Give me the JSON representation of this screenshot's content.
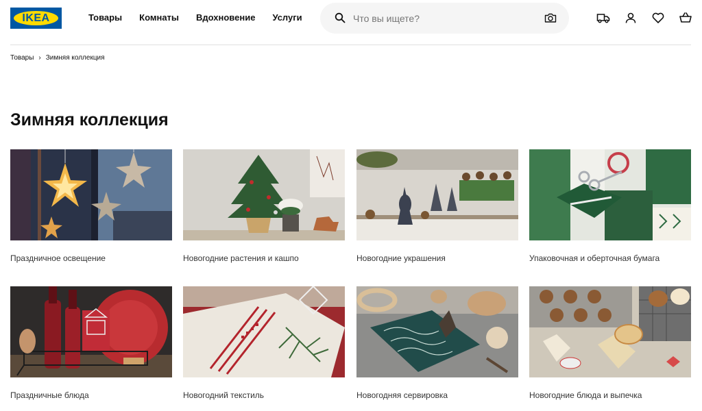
{
  "header": {
    "logo_text": "IKEA",
    "nav": [
      "Товары",
      "Комнаты",
      "Вдохновение",
      "Услуги"
    ],
    "search_placeholder": "Что вы ищете?",
    "icons": [
      "truck-icon",
      "user-icon",
      "heart-icon",
      "basket-icon"
    ]
  },
  "breadcrumb": {
    "items": [
      "Товары",
      "Зимняя коллекция"
    ]
  },
  "page": {
    "title": "Зимняя коллекция"
  },
  "categories": [
    {
      "label": "Праздничное освещение",
      "image": "Бумажные звёзды-светильники на окне"
    },
    {
      "label": "Новогодние растения и кашпо",
      "image": "Ёлочка в кашпо и пуансеттия"
    },
    {
      "label": "Новогодние украшения",
      "image": "Фигурки гномов и шишки на полке"
    },
    {
      "label": "Упаковочная и оберточная бумага",
      "image": "Зелёная подарочная бумага и ножницы"
    },
    {
      "label": "Праздничные блюда",
      "image": "Красные бутылки и корзина"
    },
    {
      "label": "Новогодний текстиль",
      "image": "Подарок в текстиле с веткой ели"
    },
    {
      "label": "Новогодняя сервировка",
      "image": "Узорное блюдо и деревянная посуда"
    },
    {
      "label": "Новогодние блюда и выпечка",
      "image": "Кексы в формочках"
    }
  ],
  "colors": {
    "brand_blue": "#0058a3",
    "brand_yellow": "#ffdb00",
    "search_bg": "#f5f5f5"
  }
}
